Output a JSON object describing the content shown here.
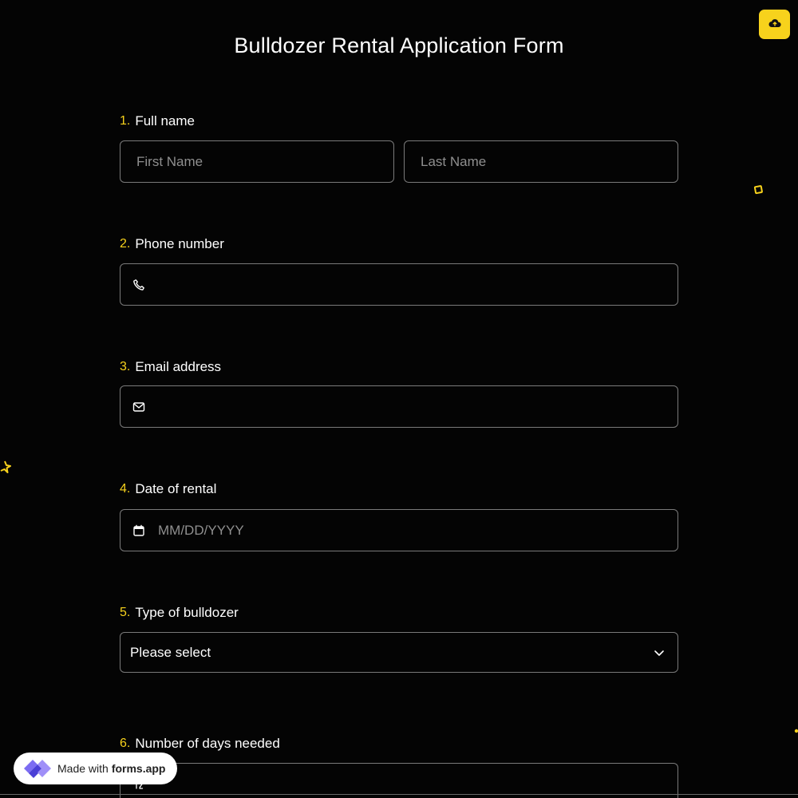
{
  "form": {
    "title": "Bulldozer Rental Application Form"
  },
  "toolbar": {
    "upload_icon": "cloud-upload-icon",
    "accent_color": "#f7d21c"
  },
  "questions": [
    {
      "number": "1.",
      "label": "Full name",
      "fields": [
        {
          "placeholder": "First Name",
          "value": ""
        },
        {
          "placeholder": "Last Name",
          "value": ""
        }
      ]
    },
    {
      "number": "2.",
      "label": "Phone number",
      "icon": "phone-icon",
      "value": ""
    },
    {
      "number": "3.",
      "label": "Email address",
      "icon": "mail-icon",
      "value": ""
    },
    {
      "number": "4.",
      "label": "Date of rental",
      "icon": "calendar-icon",
      "placeholder": "MM/DD/YYYY",
      "value": ""
    },
    {
      "number": "5.",
      "label": "Type of bulldozer",
      "selected": "Please select",
      "icon": "chevron-down-icon"
    },
    {
      "number": "6.",
      "label": "Number of days needed",
      "icon": "number-icon"
    }
  ],
  "badge": {
    "prefix": "Made with",
    "brand": "forms.app"
  }
}
